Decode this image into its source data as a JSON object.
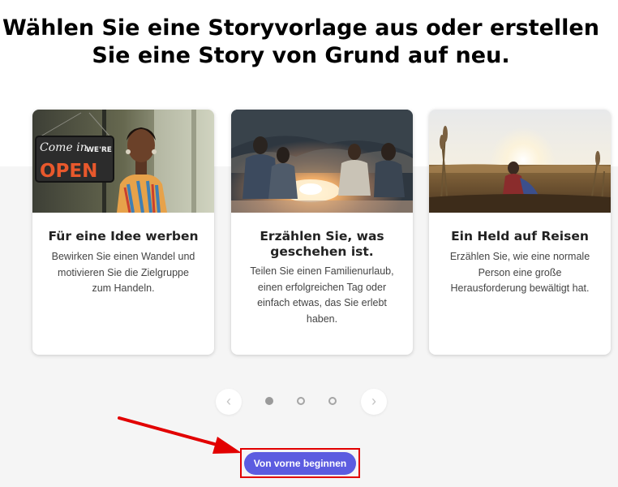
{
  "heading": {
    "line1": "Wählen Sie eine Storyvorlage aus oder erstellen",
    "line2": "Sie eine Story von Grund auf neu."
  },
  "cards": [
    {
      "title_lines": [
        "Für eine Idee werben"
      ],
      "description_lines": [
        "Bewirken Sie einen Wandel und",
        "motivieren Sie die Zielgruppe",
        "zum Handeln."
      ],
      "sign_text": {
        "line1": "Come in",
        "line2": "WE'RE",
        "line3": "OPEN"
      }
    },
    {
      "title_lines": [
        "Erzählen Sie, was",
        "geschehen ist."
      ],
      "description_lines": [
        "Teilen Sie einen Familienurlaub,",
        "einen erfolgreichen Tag oder",
        "einfach etwas, das Sie erlebt",
        "haben."
      ]
    },
    {
      "title_lines": [
        "Ein Held auf Reisen"
      ],
      "description_lines": [
        "Erzählen Sie, wie eine normale",
        "Person eine große",
        "Herausforderung bewältigt hat."
      ]
    }
  ],
  "pager": {
    "prev_icon": "chevron-left-icon",
    "next_icon": "chevron-right-icon",
    "pages": 3,
    "active_page": 1
  },
  "cta": {
    "label": "Von vorne beginnen"
  },
  "colors": {
    "cta_background": "#5c5ce0",
    "highlight_red": "#e20000",
    "page_background": "#f5f5f5"
  }
}
